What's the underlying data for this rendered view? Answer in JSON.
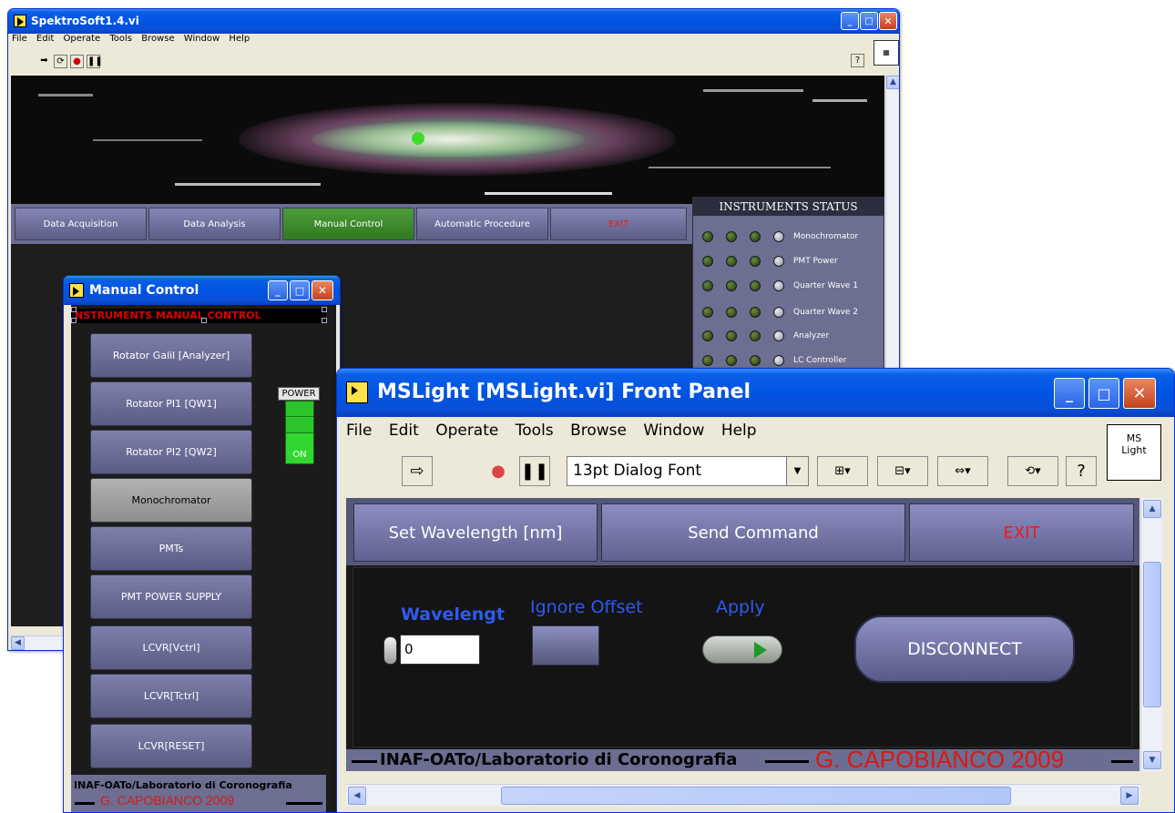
{
  "window_main": {
    "title": "SpektroSoft1.4.vi",
    "menu": [
      "File",
      "Edit",
      "Operate",
      "Tools",
      "Browse",
      "Window",
      "Help"
    ],
    "nav_buttons": [
      "Data Acquisition",
      "Data Analysis",
      "Manual Control",
      "Automatic Procedure",
      "EXIT"
    ],
    "status_panel": {
      "title": "INSTRUMENTS STATUS",
      "rows": [
        "Monochromator",
        "PMT Power",
        "Quarter Wave 1",
        "Quarter Wave 2",
        "Analyzer",
        "LC Controller"
      ]
    }
  },
  "window_manual": {
    "title": "Manual Control",
    "header": "NSTRUMENTS  MANUAL  CONTROL",
    "buttons": [
      "Rotator Galil [Analyzer]",
      "Rotator PI1 [QW1]",
      "Rotator PI2 [QW2]",
      "Monochromator",
      "PMTs",
      "PMT POWER SUPPLY",
      "LCVR[Vctrl]",
      "LCVR[Tctrl]",
      "LCVR[RESET]"
    ],
    "power_label": "POWER",
    "power_state": "ON",
    "footer_line1": "INAF-OATo/Laboratorio di Coronografia",
    "footer_line2": "G. CAPOBIANCO 2009"
  },
  "window_mslight": {
    "title": "MSLight [MSLight.vi] Front Panel",
    "menu": [
      "File",
      "Edit",
      "Operate",
      "Tools",
      "Browse",
      "Window",
      "Help"
    ],
    "font_ring": "13pt Dialog Font",
    "vi_icon_text": [
      "MS",
      "Light"
    ],
    "buttons": [
      "Set Wavelength [nm]",
      "Send Command",
      "EXIT"
    ],
    "wavelength_label": "Wavelengt",
    "wavelength_value": "0",
    "ignore_offset_label": "Ignore Offset",
    "apply_label": "Apply",
    "disconnect_label": "DISCONNECT",
    "footer_left": "INAF-OATo/Laboratorio di Coronografia",
    "footer_right": "G. CAPOBIANCO 2009"
  },
  "colors": {
    "xp_title_blue": "#0054e3",
    "labview_button": "#6b6e93",
    "manual_control_active": "#3c8a2a",
    "exit_red": "#e81b1b",
    "label_blue": "#2e5aee",
    "power_green": "#2fd72f"
  }
}
